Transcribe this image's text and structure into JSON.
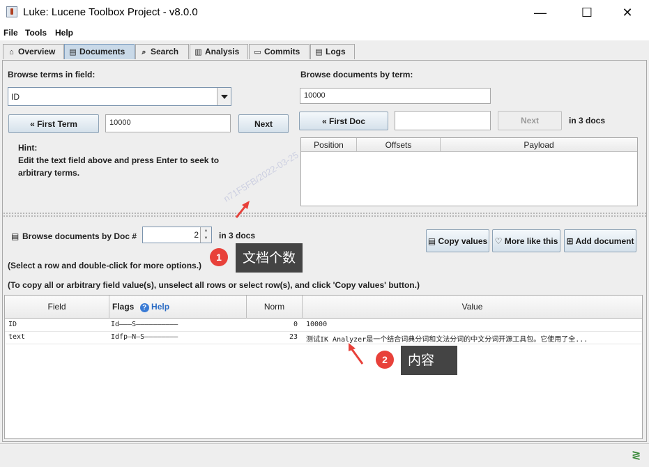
{
  "window": {
    "title": "Luke: Lucene Toolbox Project - v8.0.0",
    "minimize": "—",
    "maximize": "☐",
    "close": "✕"
  },
  "menu": [
    "File",
    "Tools",
    "Help"
  ],
  "tabs": [
    {
      "label": "Overview",
      "icon": "home-icon"
    },
    {
      "label": "Documents",
      "icon": "documents-icon"
    },
    {
      "label": "Search",
      "icon": "search-icon"
    },
    {
      "label": "Analysis",
      "icon": "analysis-icon"
    },
    {
      "label": "Commits",
      "icon": "commits-icon"
    },
    {
      "label": "Logs",
      "icon": "logs-icon"
    }
  ],
  "terms": {
    "heading": "Browse terms in field:",
    "field_value": "ID",
    "first_term_label": "« First Term",
    "term_value": "10000",
    "next_label": "Next",
    "hint_title": "Hint:",
    "hint_line1": "Edit the text field above and press Enter to seek to",
    "hint_line2": "arbitrary terms."
  },
  "by_term": {
    "heading": "Browse documents by term:",
    "term_value": "10000",
    "first_doc_label": "« First Doc",
    "doc_value": "",
    "next_label": "Next",
    "count_text": "in 3 docs",
    "columns": [
      "Position",
      "Offsets",
      "Payload"
    ]
  },
  "by_doc": {
    "label": "Browse documents by Doc #",
    "doc_number": "2",
    "count_text": "in 3 docs",
    "copy_values_label": "Copy values",
    "more_like_this_label": "More like this",
    "add_document_label": "Add document",
    "note1": "(Select a row and double-click for more options.)",
    "note2": "(To copy all or arbitrary field value(s), unselect all rows or select row(s), and click 'Copy values' button.)"
  },
  "fields_table": {
    "columns": {
      "field": "Field",
      "flags": "Flags",
      "help": "Help",
      "norm": "Norm",
      "value": "Value"
    },
    "rows": [
      {
        "field": "ID",
        "flags": "Id———S——————————",
        "norm": "0",
        "value": "10000"
      },
      {
        "field": "text",
        "flags": "Idfp—N—S————————",
        "norm": "23",
        "value": "测试IK Analyzer是一个结合词典分词和文法分词的中文分词开源工具包。它使用了全..."
      }
    ]
  },
  "annotations": [
    {
      "number": "1",
      "text": "文档个数"
    },
    {
      "number": "2",
      "text": "内容"
    }
  ],
  "watermark": "n71F5FB/2022-03-25",
  "colors": {
    "accent": "#c9d9e8",
    "annotation_badge": "#e8413a",
    "annotation_arrow": "#e8413a",
    "callout_bg": "#444444"
  }
}
